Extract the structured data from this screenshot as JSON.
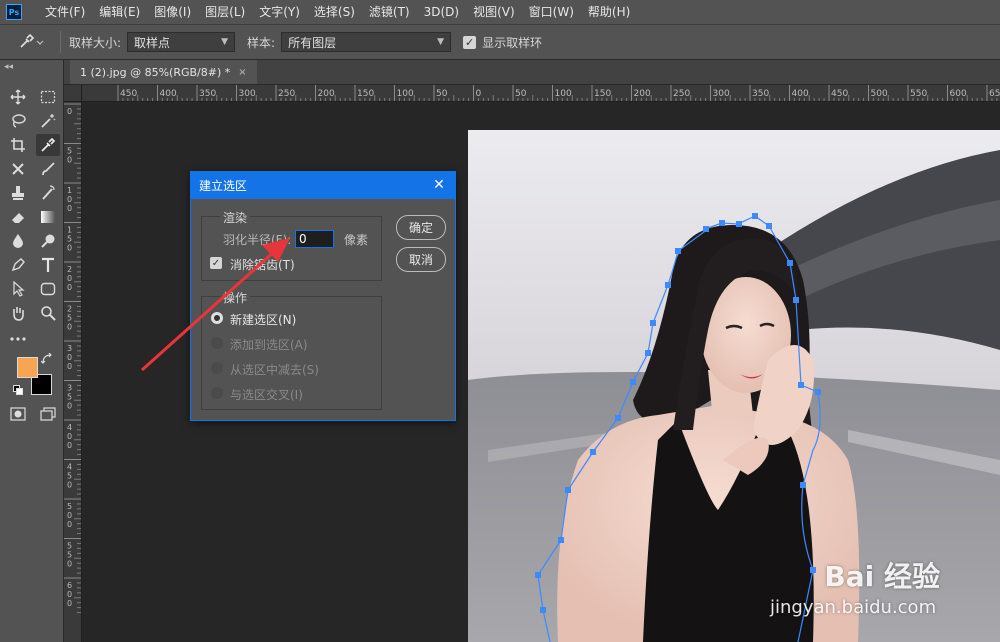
{
  "menubar": {
    "logo": "Ps",
    "items": [
      "文件(F)",
      "编辑(E)",
      "图像(I)",
      "图层(L)",
      "文字(Y)",
      "选择(S)",
      "滤镜(T)",
      "3D(D)",
      "视图(V)",
      "窗口(W)",
      "帮助(H)"
    ]
  },
  "options": {
    "sample_size_label": "取样大小:",
    "sample_size_value": "取样点",
    "sample_label": "样本:",
    "sample_value": "所有图层",
    "show_ring_label": "显示取样环",
    "show_ring_checked": true
  },
  "tab": {
    "title": "1 (2).jpg @ 85%(RGB/8#) *",
    "close": "×"
  },
  "ruler": {
    "top_labels": [
      "450",
      "400",
      "350",
      "300",
      "250",
      "200",
      "150",
      "100",
      "50",
      "0",
      "50",
      "100",
      "150",
      "200",
      "250",
      "300",
      "350",
      "400",
      "450",
      "500",
      "550",
      "600",
      "650"
    ],
    "left_labels": [
      "0",
      "5\n0",
      "1\n0\n0",
      "1\n5\n0",
      "2\n0\n0",
      "2\n5\n0",
      "3\n0\n0",
      "3\n5\n0",
      "4\n0\n0",
      "4\n5\n0",
      "5\n0\n0",
      "5\n5\n0",
      "6\n0\n0"
    ]
  },
  "colors": {
    "foreground": "#f7a552",
    "background": "#000000",
    "accent": "#1473e6"
  },
  "dialog": {
    "title": "建立选区",
    "close": "✕",
    "render_group": "渲染",
    "feather_label": "羽化半径(F):",
    "feather_value": "0",
    "feather_units": "像素",
    "antialias_label": "消除锯齿(T)",
    "antialias_checked": true,
    "operation_group": "操作",
    "ops": [
      {
        "label": "新建选区(N)",
        "selected": true
      },
      {
        "label": "添加到选区(A)",
        "selected": false
      },
      {
        "label": "从选区中减去(S)",
        "selected": false
      },
      {
        "label": "与选区交叉(I)",
        "selected": false
      }
    ],
    "ok": "确定",
    "cancel": "取消"
  },
  "watermark": {
    "brand": "Bai  经验",
    "url": "jingyan.baidu.com"
  }
}
